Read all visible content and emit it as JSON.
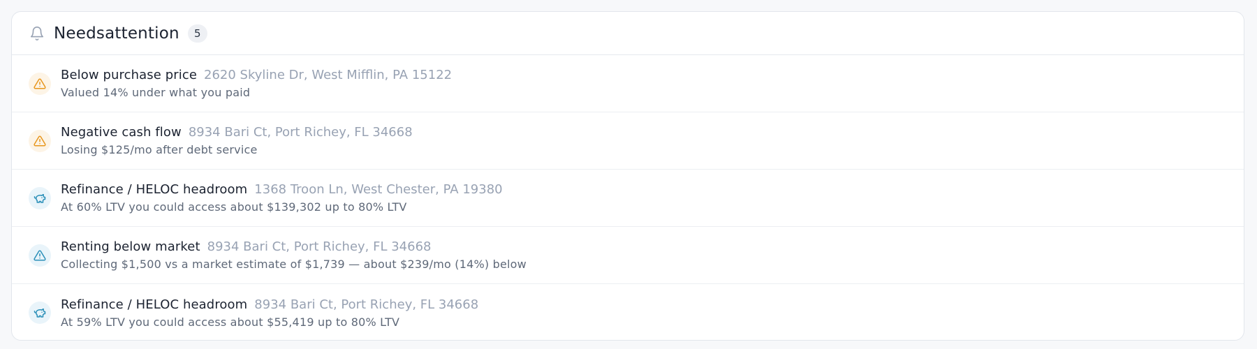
{
  "header": {
    "title": "Needsattention",
    "count": "5",
    "icon": "bell-icon"
  },
  "colors": {
    "warning": "#e8961c",
    "info": "#2a8fb8",
    "text_primary": "#1b2230",
    "text_muted": "#98a2b3"
  },
  "alerts": [
    {
      "type": "warning",
      "icon": "warning-triangle-icon",
      "title": "Below purchase price",
      "address": "2620 Skyline Dr, West Mifflin, PA 15122",
      "description": "Valued 14% under what you paid"
    },
    {
      "type": "warning",
      "icon": "warning-triangle-icon",
      "title": "Negative cash flow",
      "address": "8934 Bari Ct, Port Richey, FL 34668",
      "description": "Losing $125/mo after debt service"
    },
    {
      "type": "info",
      "icon": "piggy-bank-icon",
      "title": "Refinance / HELOC headroom",
      "address": "1368 Troon Ln, West Chester, PA 19380",
      "description": "At 60% LTV you could access about $139,302 up to 80% LTV"
    },
    {
      "type": "info",
      "icon": "warning-triangle-icon",
      "title": "Renting below market",
      "address": "8934 Bari Ct, Port Richey, FL 34668",
      "description": "Collecting $1,500 vs a market estimate of $1,739 — about $239/mo (14%) below"
    },
    {
      "type": "info",
      "icon": "piggy-bank-icon",
      "title": "Refinance / HELOC headroom",
      "address": "8934 Bari Ct, Port Richey, FL 34668",
      "description": "At 59% LTV you could access about $55,419 up to 80% LTV"
    }
  ]
}
